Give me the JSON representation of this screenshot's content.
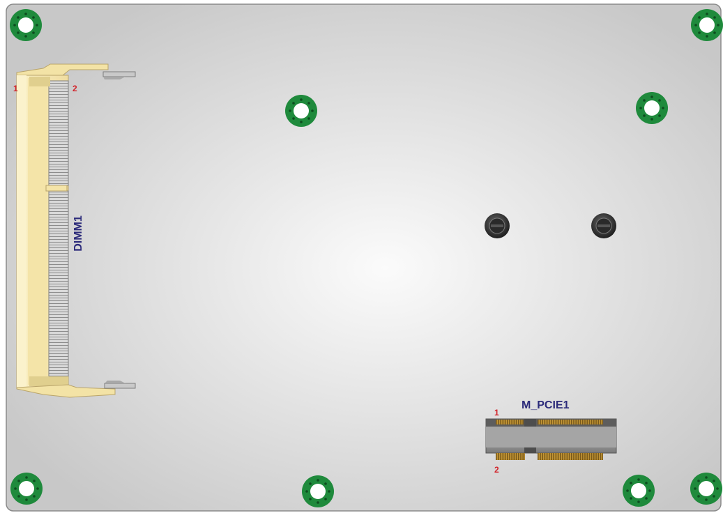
{
  "board": {
    "colors": {
      "pcb_center": "#fafafa",
      "pcb_edge": "#c9c9c9",
      "outline": "#8a8a8a",
      "mount_ring": "#1f8a3c",
      "mount_hole": "#ffffff",
      "slot_body": "#f6eab8",
      "slot_shade": "#e3d28f",
      "pin_gold": "#b98a2e",
      "connector_gray": "#8d8d8d",
      "label_red": "#d2232a",
      "label_blue": "#2b2a7a"
    },
    "mounting_holes": [
      "top-left",
      "top-right",
      "inner-left",
      "inner-right",
      "bottom-left",
      "bottom-center",
      "bottom-right-1",
      "bottom-right-2"
    ],
    "standoffs": [
      "standoff-left",
      "standoff-right"
    ]
  },
  "dimm": {
    "name": "DIMM1",
    "pin1": "1",
    "pin2": "2"
  },
  "mpcie": {
    "name": "M_PCIE1",
    "pin1": "1",
    "pin2": "2"
  }
}
